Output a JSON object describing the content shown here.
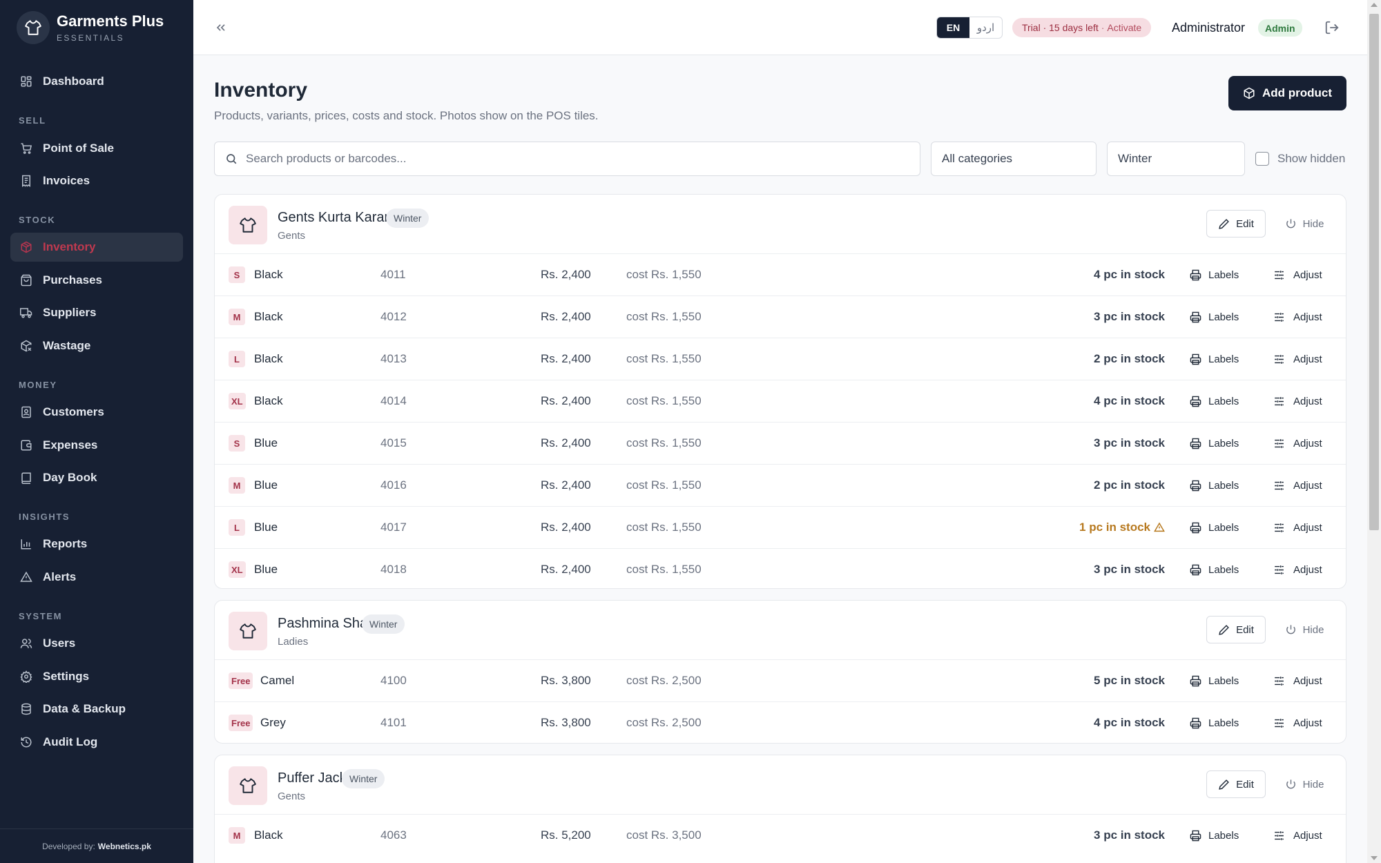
{
  "app": {
    "name": "Garments Plus",
    "subtitle": "ESSENTIALS"
  },
  "sidebar": {
    "items": [
      {
        "label": "Dashboard",
        "icon": "dashboard-icon"
      },
      {
        "section": "SELL"
      },
      {
        "label": "Point of Sale",
        "icon": "cart-icon"
      },
      {
        "label": "Invoices",
        "icon": "receipt-icon"
      },
      {
        "section": "STOCK"
      },
      {
        "label": "Inventory",
        "icon": "package-icon",
        "active": true
      },
      {
        "label": "Purchases",
        "icon": "bag-icon"
      },
      {
        "label": "Suppliers",
        "icon": "truck-icon"
      },
      {
        "label": "Wastage",
        "icon": "package-x-icon"
      },
      {
        "section": "MONEY"
      },
      {
        "label": "Customers",
        "icon": "contact-icon"
      },
      {
        "label": "Expenses",
        "icon": "wallet-icon"
      },
      {
        "label": "Day Book",
        "icon": "book-icon"
      },
      {
        "section": "INSIGHTS"
      },
      {
        "label": "Reports",
        "icon": "bar-chart-icon"
      },
      {
        "label": "Alerts",
        "icon": "alert-triangle-icon"
      },
      {
        "section": "SYSTEM"
      },
      {
        "label": "Users",
        "icon": "users-icon"
      },
      {
        "label": "Settings",
        "icon": "gear-icon"
      },
      {
        "label": "Data & Backup",
        "icon": "database-icon"
      },
      {
        "label": "Audit Log",
        "icon": "history-icon"
      }
    ],
    "footer": {
      "prefix": "Developed by:",
      "brand": "Webnetics.pk"
    }
  },
  "header": {
    "lang": {
      "en": "EN",
      "ur": "اردو"
    },
    "trial": {
      "text": "Trial · 15 days left",
      "sep": "·",
      "action": "Activate"
    },
    "user": "Administrator",
    "role": "Admin"
  },
  "page": {
    "title": "Inventory",
    "subtitle": "Products, variants, prices, costs and stock. Photos show on the POS tiles.",
    "add_button": "Add product"
  },
  "filters": {
    "search_placeholder": "Search products or barcodes...",
    "category": "All categories",
    "season": "Winter",
    "show_hidden": "Show hidden"
  },
  "actions": {
    "edit": "Edit",
    "hide": "Hide",
    "labels": "Labels",
    "adjust": "Adjust"
  },
  "products": [
    {
      "name": "Gents Kurta Karandi",
      "tag": "Winter",
      "category": "Gents",
      "variants": [
        {
          "size": "S",
          "color": "Black",
          "sku": "4011",
          "price": "Rs. 2,400",
          "cost": "cost Rs. 1,550",
          "stock": "4 pc in stock",
          "low": false
        },
        {
          "size": "M",
          "color": "Black",
          "sku": "4012",
          "price": "Rs. 2,400",
          "cost": "cost Rs. 1,550",
          "stock": "3 pc in stock",
          "low": false
        },
        {
          "size": "L",
          "color": "Black",
          "sku": "4013",
          "price": "Rs. 2,400",
          "cost": "cost Rs. 1,550",
          "stock": "2 pc in stock",
          "low": false
        },
        {
          "size": "XL",
          "color": "Black",
          "sku": "4014",
          "price": "Rs. 2,400",
          "cost": "cost Rs. 1,550",
          "stock": "4 pc in stock",
          "low": false
        },
        {
          "size": "S",
          "color": "Blue",
          "sku": "4015",
          "price": "Rs. 2,400",
          "cost": "cost Rs. 1,550",
          "stock": "3 pc in stock",
          "low": false
        },
        {
          "size": "M",
          "color": "Blue",
          "sku": "4016",
          "price": "Rs. 2,400",
          "cost": "cost Rs. 1,550",
          "stock": "2 pc in stock",
          "low": false
        },
        {
          "size": "L",
          "color": "Blue",
          "sku": "4017",
          "price": "Rs. 2,400",
          "cost": "cost Rs. 1,550",
          "stock": "1 pc in stock",
          "low": true
        },
        {
          "size": "XL",
          "color": "Blue",
          "sku": "4018",
          "price": "Rs. 2,400",
          "cost": "cost Rs. 1,550",
          "stock": "3 pc in stock",
          "low": false
        }
      ]
    },
    {
      "name": "Pashmina Shawl",
      "tag": "Winter",
      "category": "Ladies",
      "variants": [
        {
          "size": "Free",
          "color": "Camel",
          "sku": "4100",
          "price": "Rs. 3,800",
          "cost": "cost Rs. 2,500",
          "stock": "5 pc in stock",
          "low": false
        },
        {
          "size": "Free",
          "color": "Grey",
          "sku": "4101",
          "price": "Rs. 3,800",
          "cost": "cost Rs. 2,500",
          "stock": "4 pc in stock",
          "low": false
        }
      ]
    },
    {
      "name": "Puffer Jacket",
      "tag": "Winter",
      "category": "Gents",
      "variants": [
        {
          "size": "M",
          "color": "Black",
          "sku": "4063",
          "price": "Rs. 5,200",
          "cost": "cost Rs. 3,500",
          "stock": "3 pc in stock",
          "low": false
        }
      ]
    }
  ],
  "colors": {
    "sidebar": "#172033",
    "accent": "#c0394f",
    "size_badge_bg": "#f8e4e8",
    "low_stock": "#b7791f",
    "role_badge": "#e3f3e6"
  }
}
